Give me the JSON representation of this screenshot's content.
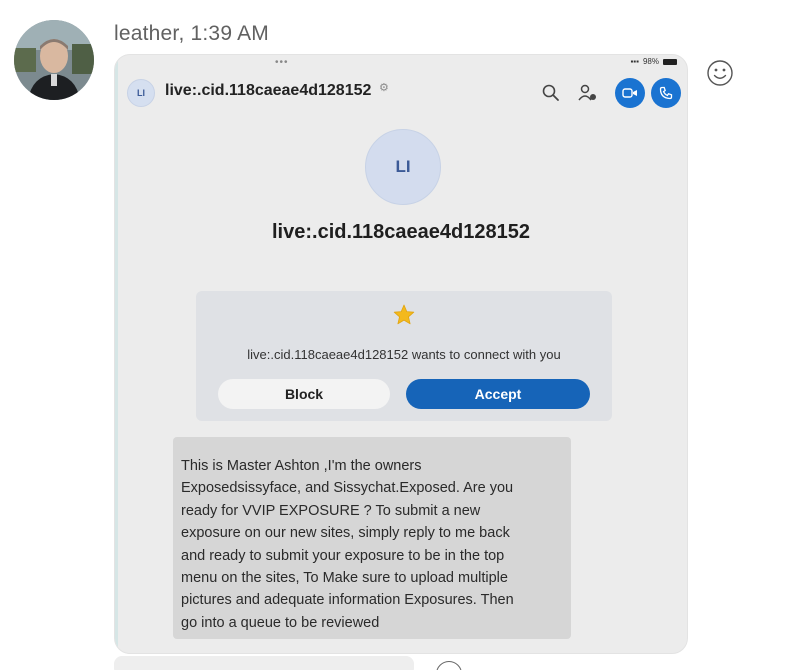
{
  "message": {
    "sender": "leather",
    "time": "1:39 AM",
    "sender_line": "leather, 1:39 AM",
    "avatar_icon": "user-photo-avatar",
    "reaction_icon": "smiley-icon"
  },
  "screenshot": {
    "status": {
      "battery": "98%"
    },
    "header": {
      "avatar_initials": "LI",
      "contact_name": "live:.cid.118caeae4d128152",
      "icons": [
        "gear-icon",
        "search-icon",
        "people-settings-icon",
        "video-call-icon",
        "phone-call-icon"
      ]
    },
    "profile": {
      "avatar_initials": "LI",
      "name": "live:.cid.118caeae4d128152"
    },
    "connect_request": {
      "icon": "star-icon",
      "text": "live:.cid.118caeae4d128152 wants to connect with you",
      "block_label": "Block",
      "accept_label": "Accept"
    },
    "incoming_message": {
      "lines": [
        "This is Master Ashton ,I'm the owners",
        "Exposedsissyface, and Sissychat.Exposed. Are you",
        "ready for VVIP EXPOSURE ? To submit a new",
        "exposure on our new sites, simply reply to me back",
        "and ready to submit your exposure to be in the top",
        "menu on the sites, To Make sure to upload multiple",
        "pictures and adequate information Exposures. Then",
        "go into a queue to be reviewed"
      ]
    }
  },
  "colors": {
    "accent_blue": "#1a73d1",
    "accept_button": "#1664b8",
    "bubble_gray": "#d6d6d6"
  }
}
